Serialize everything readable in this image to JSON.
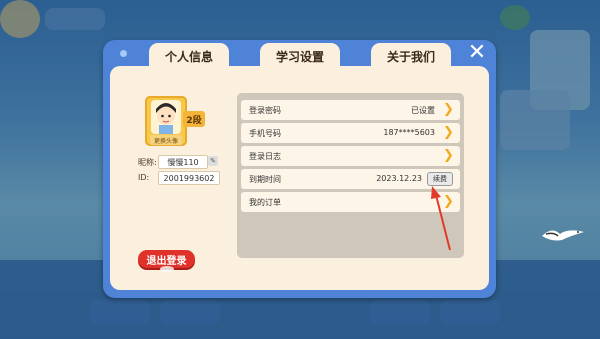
{
  "tabs": [
    {
      "label": "个人信息"
    },
    {
      "label": "学习设置"
    },
    {
      "label": "关于我们"
    }
  ],
  "profile": {
    "level": "2段",
    "change_avatar": "更换头像",
    "nickname_label": "昵称:",
    "nickname": "慢慢110",
    "id_label": "ID:",
    "id": "2001993602",
    "logout": "退出登录"
  },
  "settings": [
    {
      "label": "登录密码",
      "value": "已设置"
    },
    {
      "label": "手机号码",
      "value": "187****5603"
    },
    {
      "label": "登录日志",
      "value": ""
    },
    {
      "label": "到期时间",
      "value": "2023.12.23",
      "button": "续费"
    },
    {
      "label": "我的订单",
      "value": ""
    }
  ],
  "colors": {
    "panel": "#4f83d8",
    "content_bg": "#fbf0dd",
    "logout_button": "#e0322a",
    "arrow_accent": "#f2a81d",
    "annotation": "#e23a2a"
  },
  "icons": {
    "close": "close-icon",
    "row_arrow": "chevron-right-icon",
    "edit": "pencil-icon"
  }
}
